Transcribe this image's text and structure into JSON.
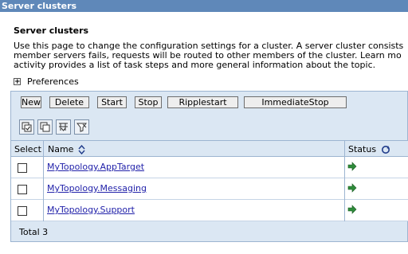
{
  "titlebar": {
    "title": "Server clusters"
  },
  "page": {
    "heading": "Server clusters",
    "description_lines": [
      "Use this page to change the configuration settings for a cluster. A server cluster consists",
      "member servers fails, requests will be routed to other members of the cluster. Learn mo",
      "activity provides a list of task steps and more general information about the topic."
    ],
    "preferences_label": "Preferences"
  },
  "toolbar": {
    "new_label": "New",
    "delete_label": "Delete",
    "start_label": "Start",
    "stop_label": "Stop",
    "ripplestart_label": "Ripplestart",
    "immediatestop_label": "ImmediateStop"
  },
  "table": {
    "headers": {
      "select": "Select",
      "name": "Name",
      "status": "Status"
    },
    "rows": [
      {
        "name": "MyTopology.AppTarget",
        "status": "started-arrow-icon",
        "selected": false
      },
      {
        "name": "MyTopology.Messaging",
        "status": "started-arrow-icon",
        "selected": false
      },
      {
        "name": "MyTopology.Support",
        "status": "started-arrow-icon",
        "selected": false
      }
    ],
    "total_label": "Total 3"
  },
  "colors": {
    "titlebar_bg": "#5f88b9",
    "panel_bg": "#dbe7f3",
    "link": "#2222aa",
    "status_arrow": "#2e8b3a"
  }
}
